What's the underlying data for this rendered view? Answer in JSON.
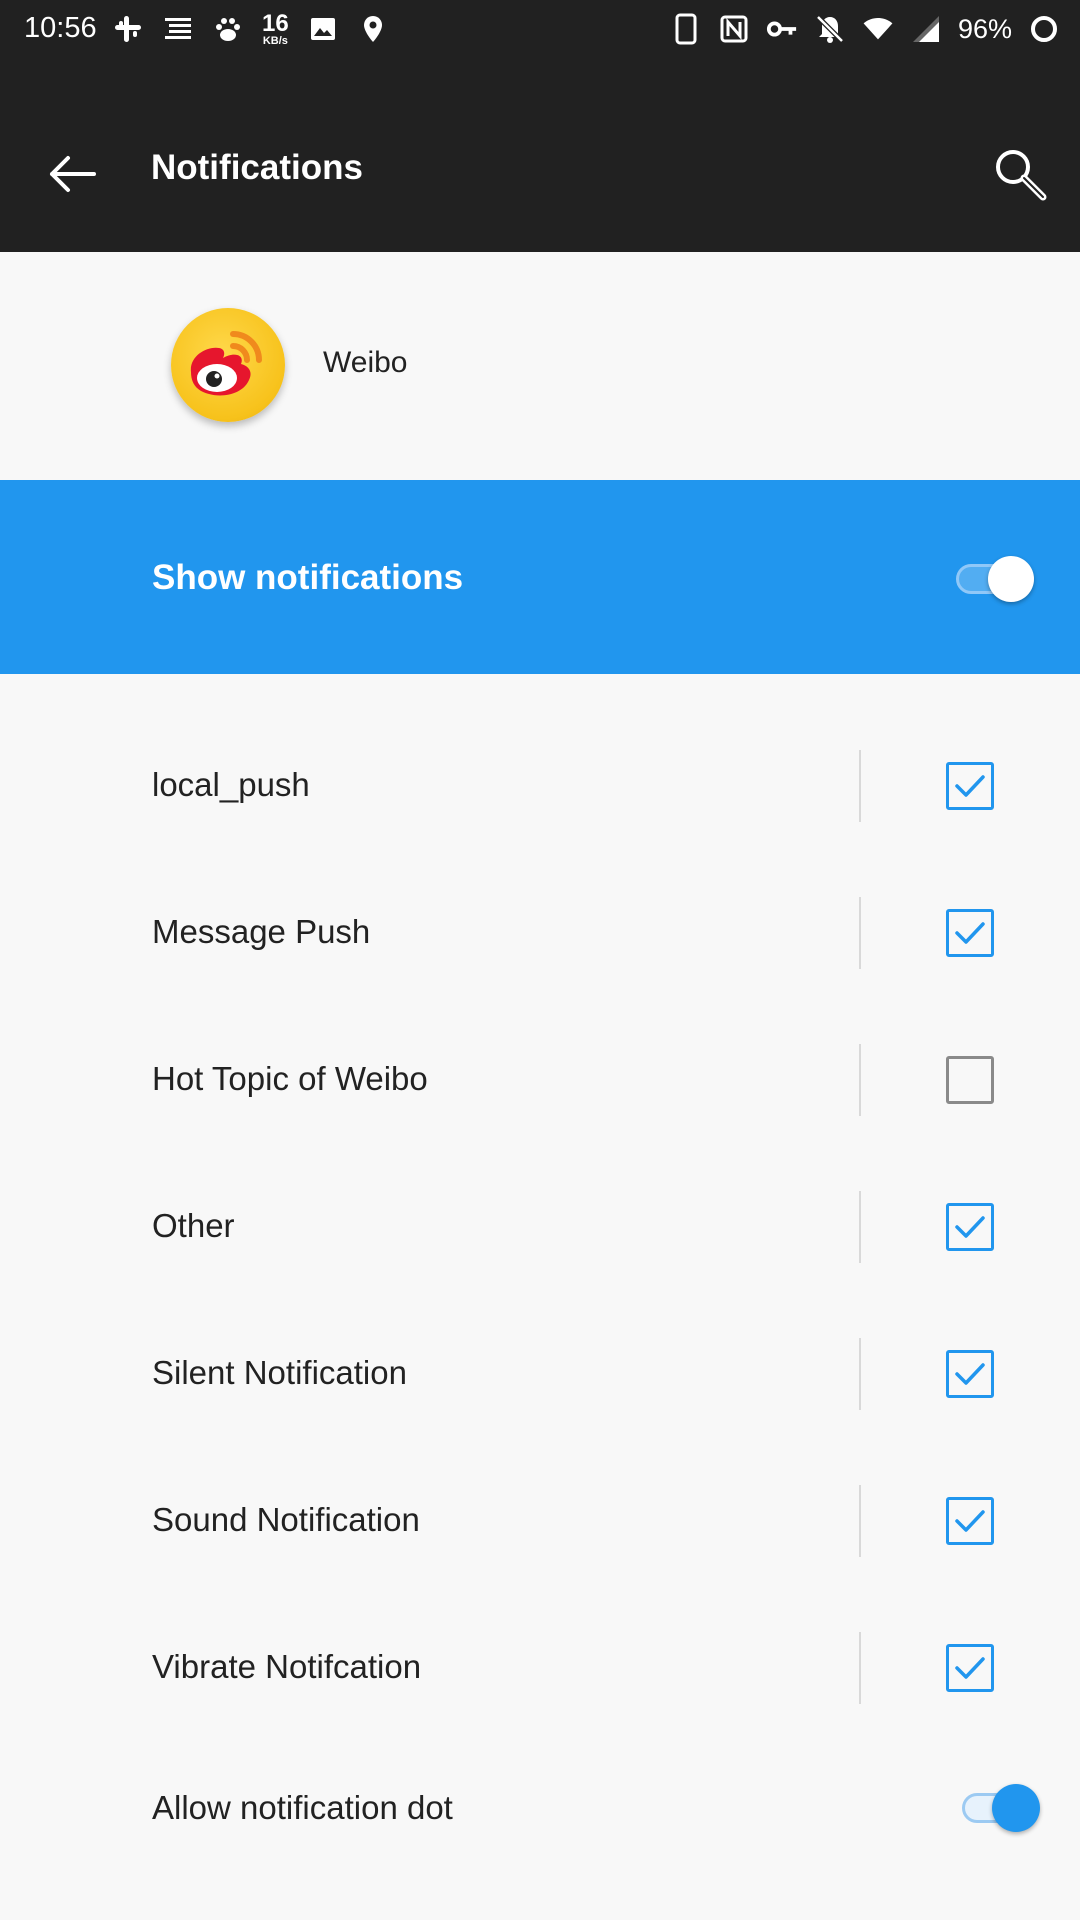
{
  "status_bar": {
    "time": "10:56",
    "net_speed_value": "16",
    "net_speed_unit": "KB/s",
    "battery_percent": "96%",
    "left_icons": [
      "slack-icon",
      "notes-icon",
      "paw-icon",
      "image-icon",
      "location-icon"
    ],
    "right_icons": [
      "phone-icon",
      "nfc-icon",
      "vpn-key-icon",
      "bell-off-icon",
      "wifi-icon",
      "signal-icon",
      "battery-icon"
    ]
  },
  "app_bar": {
    "title": "Notifications",
    "back_icon": "arrow-left-icon",
    "search_icon": "search-icon"
  },
  "app": {
    "name": "Weibo",
    "icon": "weibo-logo"
  },
  "master_toggle": {
    "label": "Show notifications",
    "on": true
  },
  "channels": [
    {
      "label": "local_push",
      "checked": true
    },
    {
      "label": "Message Push",
      "checked": true
    },
    {
      "label": "Hot Topic of Weibo",
      "checked": false
    },
    {
      "label": "Other",
      "checked": true
    },
    {
      "label": "Silent Notification",
      "checked": true
    },
    {
      "label": "Sound Notification",
      "checked": true
    },
    {
      "label": "Vibrate Notifcation",
      "checked": true
    }
  ],
  "notification_dot": {
    "label": "Allow notification dot",
    "on": true
  },
  "colors": {
    "accent": "#2196ee",
    "bar": "#212121",
    "background": "#f8f8f8"
  }
}
